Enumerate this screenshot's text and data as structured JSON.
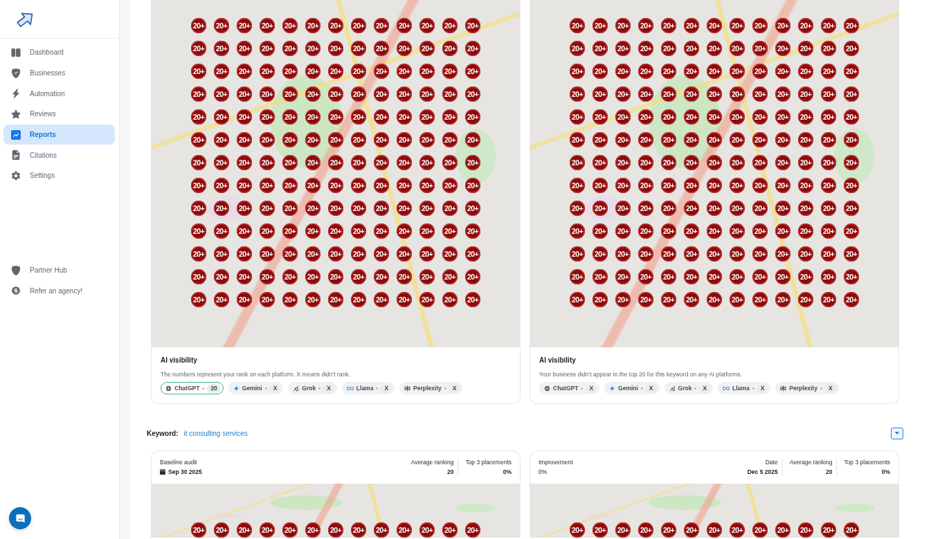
{
  "sidebar": {
    "items": [
      {
        "label": "Dashboard",
        "selected": false
      },
      {
        "label": "Businesses",
        "selected": false
      },
      {
        "label": "Automation",
        "selected": false
      },
      {
        "label": "Reviews",
        "selected": false
      },
      {
        "label": "Reports",
        "selected": true
      },
      {
        "label": "Citations",
        "selected": false
      },
      {
        "label": "Settings",
        "selected": false
      }
    ],
    "footer_items": [
      {
        "label": "Partner Hub"
      },
      {
        "label": "Refer an agency!"
      }
    ]
  },
  "top_reports": [
    {
      "map": {
        "markers": [
          [
            "20+",
            "20+",
            "20+",
            "20+",
            "20+",
            "20+",
            "20+",
            "20+",
            "20+",
            "20+",
            "20+",
            "20+",
            "20+"
          ],
          [
            "20+",
            "20+",
            "20+",
            "20+",
            "20+",
            "20+",
            "20+",
            "20+",
            "20+",
            "20+",
            "20+",
            "20+",
            "20+"
          ],
          [
            "20+",
            "20+",
            "20+",
            "20+",
            "20+",
            "20+",
            "20+",
            "20+",
            "20+",
            "20+",
            "20+",
            "20+",
            "20+"
          ],
          [
            "20+",
            "20+",
            "20+",
            "20+",
            "20+",
            "20+",
            "20+",
            "20+",
            "20+",
            "20+",
            "20+",
            "20+",
            "20+"
          ],
          [
            "20+",
            "20+",
            "20+",
            "20+",
            "20+",
            "20+",
            "20+",
            "20+",
            "20+",
            "20+",
            "20+",
            "20+",
            "20+"
          ],
          [
            "20+",
            "20+",
            "20+",
            "20+",
            "20+",
            "20+",
            "20+",
            "20+",
            "20+",
            "20+",
            "20+",
            "20+",
            "20+"
          ],
          [
            "20+",
            "20+",
            "20+",
            "20+",
            "20+",
            "20+",
            "20+",
            "20+",
            "20+",
            "20+",
            "20+",
            "20+",
            "20+"
          ],
          [
            "20+",
            "20+",
            "20+",
            "20+",
            "20+",
            "20+",
            "20+",
            "20+",
            "20+",
            "20+",
            "20+",
            "20+",
            "20+"
          ],
          [
            "20+",
            "20+",
            "20+",
            "20+",
            "20+",
            "20+",
            "20+",
            "20+",
            "20+",
            "20+",
            "20+",
            "20+",
            "20+"
          ],
          [
            "20+",
            "20+",
            "20+",
            "20+",
            "20+",
            "20+",
            "20+",
            "20+",
            "20+",
            "20+",
            "20+",
            "20+",
            "20+"
          ],
          [
            "20+",
            "20+",
            "20+",
            "20+",
            "20+",
            "20+",
            "20+",
            "20+",
            "20+",
            "20+",
            "20+",
            "20+",
            "20+"
          ],
          [
            "20+",
            "20+",
            "20+",
            "20+",
            "20+",
            "20+",
            "20+",
            "20+",
            "20+",
            "20+",
            "20+",
            "20+",
            "20+"
          ],
          [
            "20+",
            "20+",
            "20+",
            "20+",
            "20+",
            "20+",
            "20+",
            "20+",
            "20+",
            "20+",
            "20+",
            "20+",
            "20+"
          ]
        ]
      },
      "ai_visibility": {
        "title": "AI visibility",
        "description": "The numbers represent your rank on each platform. X means didn't rank.",
        "platforms": [
          {
            "name": "ChatGPT",
            "rank": "20",
            "ranked": true
          },
          {
            "name": "Gemini",
            "rank": "X",
            "ranked": false
          },
          {
            "name": "Grok",
            "rank": "X",
            "ranked": false
          },
          {
            "name": "Llama",
            "rank": "X",
            "ranked": false
          },
          {
            "name": "Perplexity",
            "rank": "X",
            "ranked": false
          }
        ]
      }
    },
    {
      "map": {
        "markers": [
          [
            "20+",
            "20+",
            "20+",
            "20+",
            "20+",
            "20+",
            "20+",
            "20+",
            "20+",
            "20+",
            "20+",
            "20+",
            "20+"
          ],
          [
            "20+",
            "20+",
            "20+",
            "20+",
            "20+",
            "20+",
            "20+",
            "20+",
            "20+",
            "20+",
            "20+",
            "20+",
            "20+"
          ],
          [
            "20+",
            "20+",
            "20+",
            "20+",
            "20+",
            "20+",
            "20+",
            "20+",
            "20+",
            "20+",
            "20+",
            "20+",
            "20+"
          ],
          [
            "20+",
            "20+",
            "20+",
            "20+",
            "20+",
            "20+",
            "20+",
            "20+",
            "20+",
            "20+",
            "20+",
            "20+",
            "20+"
          ],
          [
            "20+",
            "20+",
            "20+",
            "20+",
            "20+",
            "20+",
            "20+",
            "20+",
            "20+",
            "20+",
            "20+",
            "20+",
            "20+"
          ],
          [
            "20+",
            "20+",
            "20+",
            "20+",
            "20+",
            "20+",
            "20+",
            "20+",
            "20+",
            "20+",
            "20+",
            "20+",
            "20+"
          ],
          [
            "20+",
            "20+",
            "20+",
            "20+",
            "20+",
            "20+",
            "20+",
            "20+",
            "20+",
            "20+",
            "20+",
            "20+",
            "20+"
          ],
          [
            "20+",
            "20+",
            "20+",
            "20+",
            "20+",
            "20+",
            "20+",
            "20+",
            "20+",
            "20+",
            "20+",
            "20+",
            "20+"
          ],
          [
            "20+",
            "20+",
            "20+",
            "20+",
            "20+",
            "20+",
            "20+",
            "20+",
            "20+",
            "20+",
            "20+",
            "20+",
            "20+"
          ],
          [
            "20+",
            "20+",
            "20+",
            "20+",
            "20+",
            "20+",
            "20+",
            "20+",
            "20+",
            "20+",
            "20+",
            "20+",
            "20+"
          ],
          [
            "20+",
            "20+",
            "20+",
            "20+",
            "20+",
            "20+",
            "20+",
            "20+",
            "20+",
            "20+",
            "20+",
            "20+",
            "20+"
          ],
          [
            "20+",
            "20+",
            "20+",
            "20+",
            "20+",
            "20+",
            "20+",
            "20+",
            "20+",
            "20+",
            "20+",
            "20+",
            "20+"
          ],
          [
            "20+",
            "20+",
            "20+",
            "20+",
            "20+",
            "20+",
            "20+",
            "20+",
            "20+",
            "20+",
            "20+",
            "20+",
            "20+"
          ]
        ]
      },
      "ai_visibility": {
        "title": "AI visibility",
        "description": "Your business didn't appear in the top 20 for this keyword on any AI platforms.",
        "platforms": [
          {
            "name": "ChatGPT",
            "rank": "X",
            "ranked": false
          },
          {
            "name": "Gemini",
            "rank": "X",
            "ranked": false
          },
          {
            "name": "Grok",
            "rank": "X",
            "ranked": false
          },
          {
            "name": "Llama",
            "rank": "X",
            "ranked": false
          },
          {
            "name": "Perplexity",
            "rank": "X",
            "ranked": false
          }
        ]
      }
    }
  ],
  "keyword": {
    "label": "Keyword:",
    "value": "it consulting services"
  },
  "bottom_reports": [
    {
      "summary": {
        "kind": "date",
        "label": "Baseline audit",
        "value": "Sep 30 2025"
      },
      "stats": [
        {
          "label": "Average ranking",
          "value": "20"
        },
        {
          "label": "Top 3 placements",
          "value": "0%"
        }
      ],
      "map": {
        "markers": [
          [
            "20+",
            "20+",
            "20+",
            "20+",
            "20+",
            "20+",
            "20+",
            "20+",
            "20+",
            "20+",
            "20+",
            "20+",
            "20+"
          ]
        ]
      }
    },
    {
      "summary": {
        "kind": "plain",
        "label": "Improvement",
        "value": "0%"
      },
      "stats": [
        {
          "label": "Date",
          "value": "Dec 5 2025"
        },
        {
          "label": "Average ranking",
          "value": "20"
        },
        {
          "label": "Top 3 placements",
          "value": "0%"
        }
      ],
      "map": {
        "markers": [
          [
            "20+",
            "20+",
            "20+",
            "20+",
            "20+",
            "20+",
            "20+",
            "20+",
            "20+",
            "20+",
            "20+",
            "20+",
            "20+"
          ]
        ]
      }
    }
  ]
}
